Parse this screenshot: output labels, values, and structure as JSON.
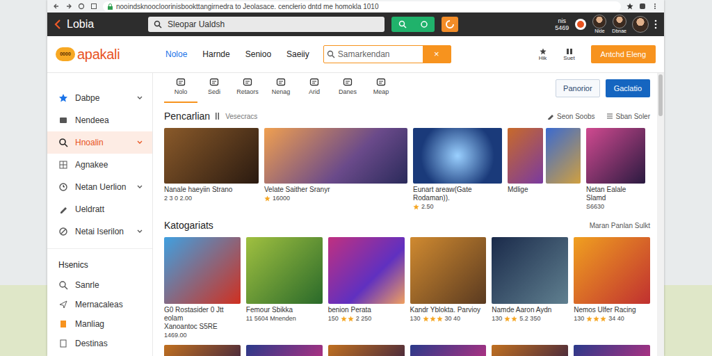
{
  "browser": {
    "url": "nooindsknoocloorinisbookttangirnedra to Jeolasace. cencłerio dntd me homokla 1010"
  },
  "topbar": {
    "title": "Lobia",
    "search": {
      "placeholder": "Sleopar Ualdsh"
    },
    "user_label": "nis",
    "user_count": "5469",
    "profiles": [
      {
        "label": "Nlde"
      },
      {
        "label": "Dbnae"
      }
    ]
  },
  "header": {
    "logo_badge": "0000",
    "logo": "apakali",
    "nav": [
      {
        "label": "Noloe",
        "selected": true
      },
      {
        "label": "Harnde",
        "selected": false
      },
      {
        "label": "Senioo",
        "selected": false
      },
      {
        "label": "Saeiiy",
        "selected": false
      }
    ],
    "search": {
      "placeholder": "Samarkendan",
      "clear": "×"
    },
    "icons": [
      {
        "label": "Hik"
      },
      {
        "label": "Suet"
      }
    ],
    "cta": "Antchd Eleng"
  },
  "sidebar": {
    "items": [
      {
        "label": "Dabpe",
        "selected": false,
        "expandable": true
      },
      {
        "label": "Nendeea",
        "selected": false,
        "expandable": false
      },
      {
        "label": "Hnoalin",
        "selected": true,
        "expandable": true
      },
      {
        "label": "Agnakee",
        "selected": false,
        "expandable": false
      },
      {
        "label": "Netan Uerlion",
        "selected": false,
        "expandable": true
      },
      {
        "label": "Ueldratt",
        "selected": false,
        "expandable": false
      },
      {
        "label": "Netai Iserilon",
        "selected": false,
        "expandable": true
      }
    ],
    "section_title": "Hsenics",
    "section_items": [
      {
        "label": "Sanrle"
      },
      {
        "label": "Mernacaleas"
      },
      {
        "label": "Manliag"
      },
      {
        "label": "Destinas"
      }
    ]
  },
  "tabs": [
    {
      "label": "Nolo",
      "selected": true
    },
    {
      "label": "Sedi",
      "selected": false
    },
    {
      "label": "Retaors",
      "selected": false
    },
    {
      "label": "Nenag",
      "selected": false
    },
    {
      "label": "Arid",
      "selected": false
    },
    {
      "label": "Danes",
      "selected": false
    },
    {
      "label": "Meap",
      "selected": false
    }
  ],
  "toolbar": [
    "Panorior",
    "Gaclatio"
  ],
  "sections": [
    {
      "title": "Pencarlian",
      "subtitle": "Vesecracs",
      "links": [
        "Seon Soobs",
        "Sban Soler"
      ],
      "cards": [
        {
          "title": "Nanale haeyiin Strano",
          "meta_after": "2 3 0 2.00"
        },
        {
          "title": "Velate Saither Sranyr",
          "stars": 1,
          "meta_after": "16000"
        },
        {
          "title": "Eunart areaw(Gate Rodaman)).",
          "stars": 1,
          "meta_after": "2.50"
        },
        {
          "title": "Mdlige"
        },
        {
          "title": "Netan Ealale Slamd",
          "meta_after": "S6630"
        }
      ]
    },
    {
      "title": "Katogariats",
      "links": [
        "Maran Panlan Sulkt"
      ],
      "cards": [
        {
          "title": "G0 Rostasider 0 Jtt eolam",
          "subtitle": "Xanoantoc S5RE",
          "meta_after": "1469.00"
        },
        {
          "title": "Femour Sbikka",
          "meta_after": "11 5604 Mnenden"
        },
        {
          "title": "benion Perata",
          "meta_before": "150",
          "stars": 2,
          "meta_after": "2 250"
        },
        {
          "title": "Kandr Yblokta. Parvioy",
          "meta_before": "130",
          "stars": 3,
          "meta_after": "30 40"
        },
        {
          "title": "Namde Aaron Aydn",
          "meta_before": "130",
          "stars": 2,
          "meta_after": "5.2 350"
        },
        {
          "title": "Nemos Ulfer Racing",
          "meta_before": "130",
          "stars": 3,
          "meta_after": "34 40"
        }
      ]
    }
  ]
}
